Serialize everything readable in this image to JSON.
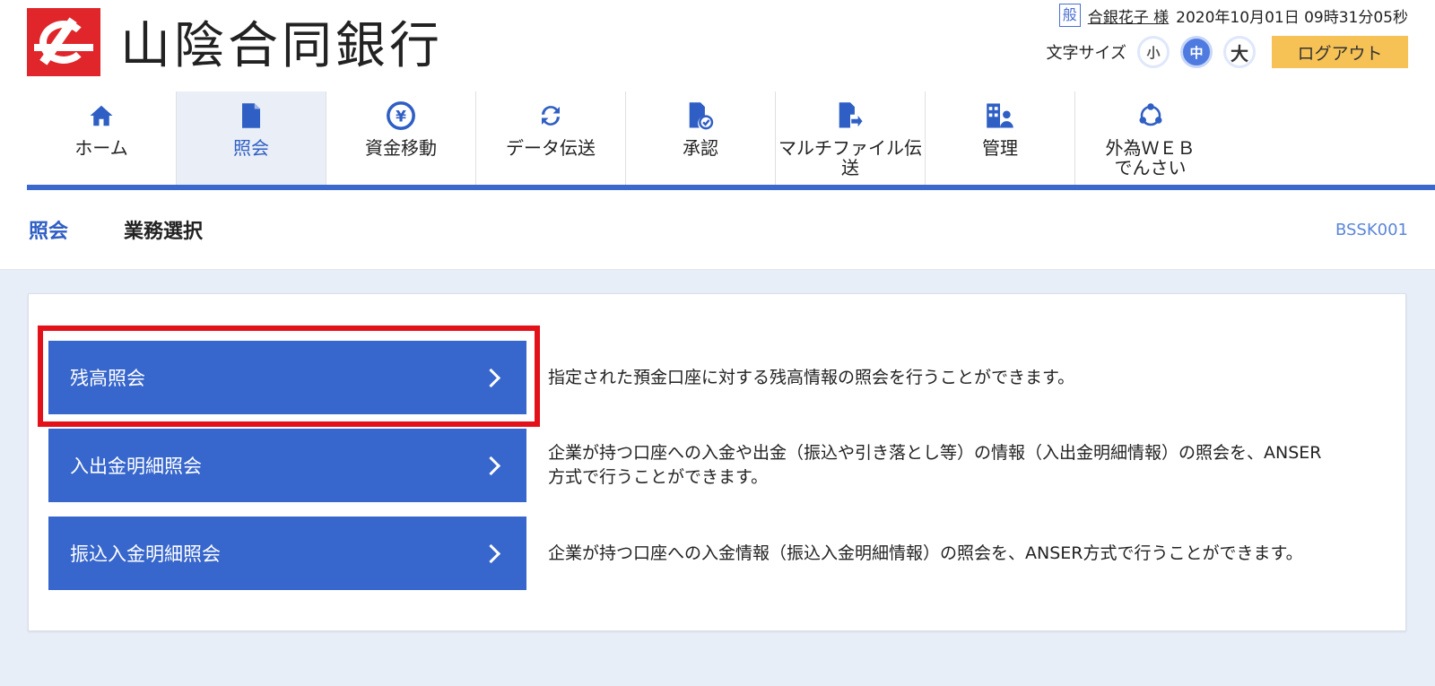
{
  "header": {
    "bank_name": "山陰合同銀行",
    "user_badge": "般",
    "user_name": "合銀花子 様",
    "datetime": "2020年10月01日 09時31分05秒",
    "font_size_label": "文字サイズ",
    "font_sizes": [
      "小",
      "中",
      "大"
    ],
    "logout_label": "ログアウト"
  },
  "nav": {
    "items": [
      {
        "label": "ホーム",
        "icon": "home-icon"
      },
      {
        "label": "照会",
        "icon": "document-icon"
      },
      {
        "label": "資金移動",
        "icon": "yen-transfer-icon"
      },
      {
        "label": "データ伝送",
        "icon": "refresh-icon"
      },
      {
        "label": "承認",
        "icon": "approve-document-icon"
      },
      {
        "label": "マルチファイル伝送",
        "icon": "file-send-icon"
      },
      {
        "label": "管理",
        "icon": "admin-icon"
      },
      {
        "label": "外為ＷＥＢでんさい",
        "icon": "network-icon"
      }
    ]
  },
  "page": {
    "category": "照会",
    "title": "業務選択",
    "screen_id": "BSSK001"
  },
  "menu": [
    {
      "label": "残高照会",
      "desc": "指定された預金口座に対する残高情報の照会を行うことができます。"
    },
    {
      "label": "入出金明細照会",
      "desc": "企業が持つ口座への入金や出金（振込や引き落とし等）の情報（入出金明細情報）の照会を、ANSER方式で行うことができます。"
    },
    {
      "label": "振込入金明細照会",
      "desc": "企業が持つ口座への入金情報（振込入金明細情報）の照会を、ANSER方式で行うことができます。"
    }
  ],
  "colors": {
    "primary": "#3766cc",
    "highlight": "#e3121a",
    "logout": "#f6c255",
    "brand": "#e0262b"
  }
}
